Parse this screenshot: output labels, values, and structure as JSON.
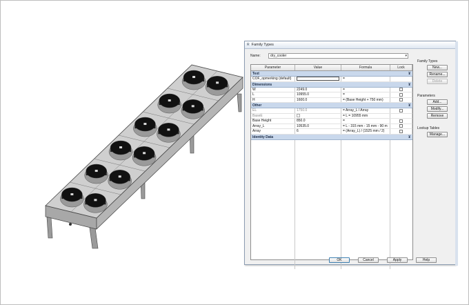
{
  "dialog": {
    "title": "Family Types",
    "name_label": "Name:",
    "name_value": "dry_cooler",
    "columns": [
      "Parameter",
      "Value",
      "Formula",
      "Lock"
    ],
    "groups": [
      {
        "label": "Text",
        "rows": [
          {
            "parameter": "COF_opmerking (default)",
            "value": "",
            "formula": "=",
            "editing": true
          }
        ]
      },
      {
        "label": "Dimensions",
        "rows": [
          {
            "parameter": "W",
            "value": "2249.0",
            "formula": "="
          },
          {
            "parameter": "L",
            "value": "10955.0",
            "formula": "="
          },
          {
            "parameter": "H",
            "value": "1600.0",
            "formula": "= (Base Height + 750 mm)"
          }
        ]
      },
      {
        "label": "Other",
        "rows": [
          {
            "parameter": "EL",
            "value": "1750.0",
            "formula": "= Array_L / Array",
            "dim": true
          },
          {
            "parameter": "BaseE",
            "value": "",
            "formula": "= L = 10955 mm",
            "dim": true
          },
          {
            "parameter": "Base Height",
            "value": "850.0",
            "formula": "="
          },
          {
            "parameter": "Array_L",
            "value": "10535.0",
            "formula": "= L - 315 mm - 15 mm - 90 m"
          },
          {
            "parameter": "Array",
            "value": "6",
            "formula": "= (Array_L) / (1525 mm / 2)"
          }
        ]
      },
      {
        "label": "Identity Data",
        "rows": []
      }
    ],
    "group_toggle": "¥"
  },
  "side_panel": {
    "family_types_label": "Family Types",
    "new_label": "New...",
    "rename_label": "Rename...",
    "delete_label": "Delete",
    "parameters_label": "Parameters",
    "add_label": "Add...",
    "modify_label": "Modify...",
    "remove_label": "Remove",
    "lookup_label": "Lookup Tables",
    "manage_label": "Manage..."
  },
  "footer": {
    "ok_label": "OK",
    "cancel_label": "Cancel",
    "apply_label": "Apply",
    "help_label": "Help"
  },
  "model": {
    "fan_count": 12,
    "colors": {
      "base": "#bfbfbf",
      "top": "#d6d6d6",
      "fan": "#111111",
      "ring": "#9a9a9a"
    }
  }
}
